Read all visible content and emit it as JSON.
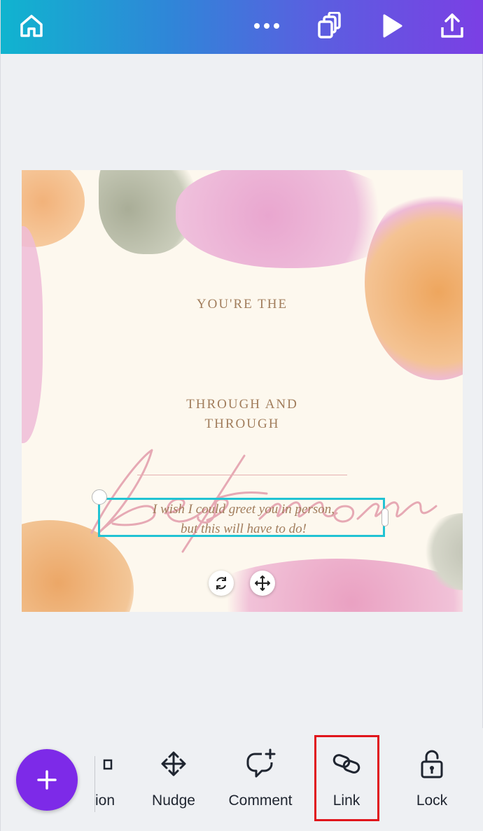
{
  "toolbar": {
    "icons": [
      "home-icon",
      "more-icon",
      "duplicate-page-icon",
      "present-play-icon",
      "share-upload-icon"
    ],
    "gradient": [
      "#10b4cf",
      "#7b3fe4"
    ]
  },
  "design": {
    "line1": "YOU'RE THE",
    "script_text": "best mom",
    "line2": "THROUGH AND",
    "line3": "THROUGH",
    "greeting_line1": "I wish I could greet you in person,",
    "greeting_line2": "but this will have to do!",
    "text_color": "#a17d5c",
    "script_color": "#e6a9b4",
    "selection_color": "#21c3d3"
  },
  "bottom_toolbar": {
    "add_button_color": "#7d2ae8",
    "items": [
      {
        "label": "ion",
        "icon": "position-icon"
      },
      {
        "label": "Nudge",
        "icon": "nudge-arrows-icon"
      },
      {
        "label": "Comment",
        "icon": "comment-add-icon"
      },
      {
        "label": "Link",
        "icon": "link-icon"
      },
      {
        "label": "Lock",
        "icon": "lock-icon"
      }
    ],
    "highlighted": "Link",
    "highlight_color": "#e0151b"
  }
}
